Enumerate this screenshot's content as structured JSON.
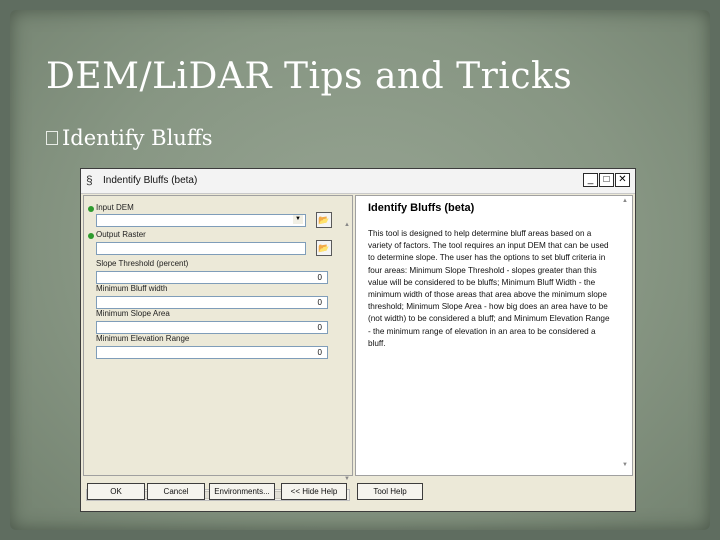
{
  "slide": {
    "title": "DEM/LiDAR Tips and Tricks",
    "bullet": "Identify Bluffs"
  },
  "window": {
    "icon": "tool-icon",
    "title": "Indentify Bluffs (beta)",
    "controls": {
      "minimize": "_",
      "maximize": "□",
      "close": "✕"
    }
  },
  "params": [
    {
      "label": "Input DEM",
      "required": true,
      "value": ""
    },
    {
      "label": "Output Raster",
      "required": true,
      "value": ""
    },
    {
      "label": "Slope Threshold (percent)",
      "required": false,
      "value": "0"
    },
    {
      "label": "Minimum Bluff width",
      "required": false,
      "value": "0"
    },
    {
      "label": "Minimum Slope Area",
      "required": false,
      "value": "0"
    },
    {
      "label": "Minimum Elevation Range",
      "required": false,
      "value": "0"
    }
  ],
  "help": {
    "title": "Identify Bluffs (beta)",
    "text": "This tool is designed to help determine bluff areas based on a variety of factors. The tool requires an input DEM that can be used to determine slope. The user has the options to set bluff criteria in four areas: Minimum Slope Threshold - slopes greater than this value will be considered to be bluffs; Minimum Bluff Width - the minimum width of those areas that area above the minimum slope threshold; Minimum Slope Area - how big does an area have to be (not width) to be considered a bluff; and Minimum Elevation Range - the minimum range of elevation in an area to be considered a bluff."
  },
  "buttons": {
    "ok": "OK",
    "cancel": "Cancel",
    "environments": "Environments...",
    "hide_help": "<< Hide Help",
    "tool_help": "Tool Help"
  },
  "colors": {
    "slide_bg": "#879683",
    "required_dot": "#2e9b2e",
    "dialog_bg": "#ece9d8"
  }
}
